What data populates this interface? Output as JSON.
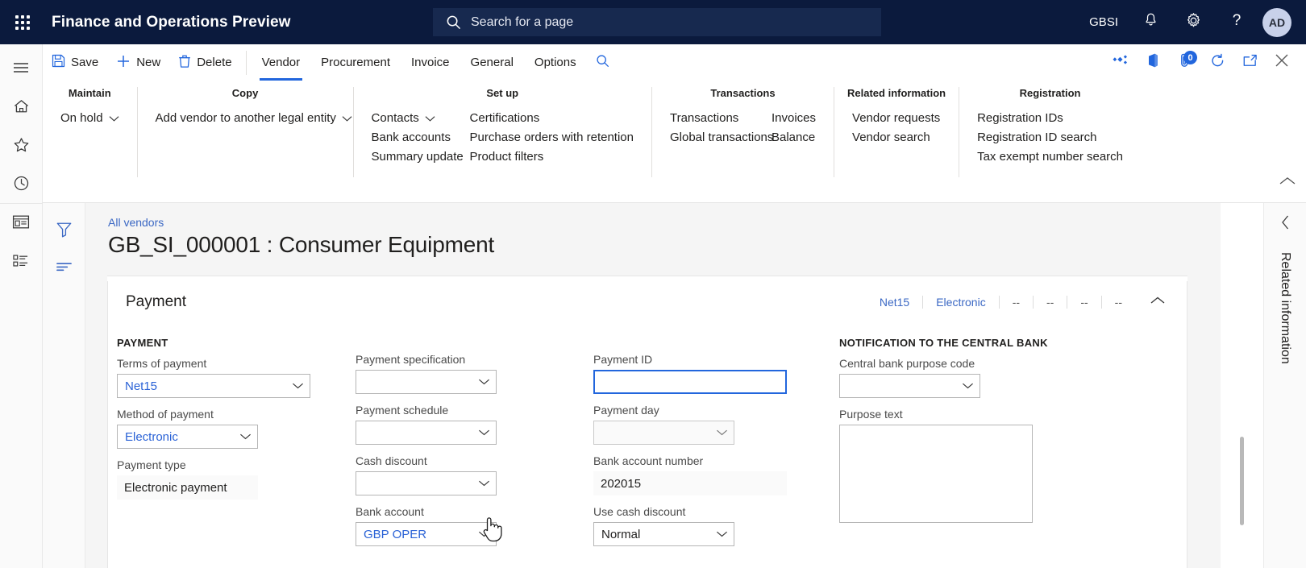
{
  "topbar": {
    "waffle_icon": "waffle-grid-icon",
    "app_title": "Finance and Operations Preview",
    "search": {
      "placeholder": "Search for a page",
      "icon": "search-icon"
    },
    "company": "GBSI",
    "notifications_icon": "bell-icon",
    "settings_icon": "gear-icon",
    "help_icon": "question-mark-icon",
    "avatar_initials": "AD",
    "bg_color": "#0b1a3d",
    "search_bg_color": "#17294f"
  },
  "left_rail": {
    "items": [
      {
        "name": "hamburger-menu",
        "icon": "hamburger-icon"
      },
      {
        "name": "home",
        "icon": "home-icon"
      },
      {
        "name": "favorites",
        "icon": "star-icon"
      },
      {
        "name": "recent",
        "icon": "clock-icon"
      },
      {
        "name": "workspaces",
        "icon": "workspace-icon"
      },
      {
        "name": "modules",
        "icon": "list-icon"
      }
    ]
  },
  "action_pane": {
    "save_label": "Save",
    "new_label": "New",
    "delete_label": "Delete",
    "tabs": [
      {
        "label": "Vendor",
        "active": true
      },
      {
        "label": "Procurement",
        "active": false
      },
      {
        "label": "Invoice",
        "active": false
      },
      {
        "label": "General",
        "active": false
      },
      {
        "label": "Options",
        "active": false
      }
    ],
    "search_icon": "search-icon",
    "right_icons": [
      {
        "name": "share-icon"
      },
      {
        "name": "office-app-icon"
      },
      {
        "name": "attachment-icon",
        "badge": "0"
      },
      {
        "name": "refresh-icon"
      },
      {
        "name": "popout-icon"
      },
      {
        "name": "close-icon"
      }
    ],
    "accent_color": "#2266dd"
  },
  "ribbon": {
    "groups": [
      {
        "title": "Maintain",
        "columns": [
          {
            "items": [
              {
                "label": "On hold",
                "chevron": true
              }
            ]
          }
        ]
      },
      {
        "title": "Copy",
        "columns": [
          {
            "items": [
              {
                "label": "Add vendor to another legal entity",
                "chevron": true
              }
            ]
          }
        ]
      },
      {
        "title": "Set up",
        "columns": [
          {
            "items": [
              {
                "label": "Contacts",
                "chevron": true
              },
              {
                "label": "Bank accounts",
                "chevron": false
              },
              {
                "label": "Summary update",
                "chevron": false
              }
            ]
          },
          {
            "items": [
              {
                "label": "Certifications",
                "chevron": false
              },
              {
                "label": "Purchase orders with retention",
                "chevron": false
              },
              {
                "label": "Product filters",
                "chevron": false
              }
            ]
          }
        ]
      },
      {
        "title": "Transactions",
        "columns": [
          {
            "items": [
              {
                "label": "Transactions",
                "chevron": false
              },
              {
                "label": "Global transactions",
                "chevron": false
              }
            ]
          },
          {
            "items": [
              {
                "label": "Invoices",
                "chevron": false
              },
              {
                "label": "Balance",
                "chevron": false
              }
            ]
          }
        ]
      },
      {
        "title": "Related information",
        "columns": [
          {
            "items": [
              {
                "label": "Vendor requests",
                "chevron": false
              },
              {
                "label": "Vendor search",
                "chevron": false
              }
            ]
          }
        ]
      },
      {
        "title": "Registration",
        "columns": [
          {
            "items": [
              {
                "label": "Registration IDs",
                "chevron": false
              },
              {
                "label": "Registration ID search",
                "chevron": false
              },
              {
                "label": "Tax exempt number search",
                "chevron": false
              }
            ]
          }
        ]
      }
    ],
    "collapse_icon": "chevron-up-icon"
  },
  "filter_rail": {
    "items": [
      {
        "name": "filter",
        "icon": "funnel-icon"
      },
      {
        "name": "show-filters",
        "icon": "filter-lines-icon"
      }
    ]
  },
  "page": {
    "breadcrumb": "All vendors",
    "title": "GB_SI_000001 : Consumer Equipment"
  },
  "payment_section": {
    "header": "Payment",
    "summary": [
      {
        "text": "Net15",
        "link": true
      },
      {
        "text": "Electronic",
        "link": true
      },
      {
        "text": "--",
        "link": false
      },
      {
        "text": "--",
        "link": false
      },
      {
        "text": "--",
        "link": false
      },
      {
        "text": "--",
        "link": false
      }
    ],
    "collapse_icon": "chevron-up-icon",
    "column1": {
      "group_label": "PAYMENT",
      "fields": [
        {
          "label": "Terms of payment",
          "value": "Net15",
          "type": "combobox",
          "blue": true
        },
        {
          "label": "Method of payment",
          "value": "Electronic",
          "type": "combobox",
          "blue": true
        },
        {
          "label": "Payment type",
          "value": "Electronic payment",
          "type": "readonly"
        }
      ]
    },
    "column2": {
      "fields": [
        {
          "label": "Payment specification",
          "value": "",
          "type": "combobox"
        },
        {
          "label": "Payment schedule",
          "value": "",
          "type": "combobox"
        },
        {
          "label": "Cash discount",
          "value": "",
          "type": "combobox"
        },
        {
          "label": "Bank account",
          "value": "GBP OPER",
          "type": "combobox",
          "blue": true
        }
      ]
    },
    "column3": {
      "fields": [
        {
          "label": "Payment ID",
          "value": "",
          "type": "text",
          "focused": true
        },
        {
          "label": "Payment day",
          "value": "",
          "type": "combobox",
          "disabled": true
        },
        {
          "label": "Bank account number",
          "value": "202015",
          "type": "readonly"
        },
        {
          "label": "Use cash discount",
          "value": "Normal",
          "type": "combobox"
        }
      ]
    },
    "column4": {
      "group_label": "NOTIFICATION TO THE CENTRAL BANK",
      "fields": [
        {
          "label": "Central bank purpose code",
          "value": "",
          "type": "combobox"
        },
        {
          "label": "Purpose text",
          "value": "",
          "type": "textarea"
        }
      ]
    }
  },
  "right_rail": {
    "collapse_icon": "chevron-left-icon",
    "label": "Related information"
  },
  "colors": {
    "accent": "#2266dd",
    "link": "#3b68c4",
    "nav_bg": "#0b1a3d",
    "content_bg": "#f5f5f5"
  }
}
